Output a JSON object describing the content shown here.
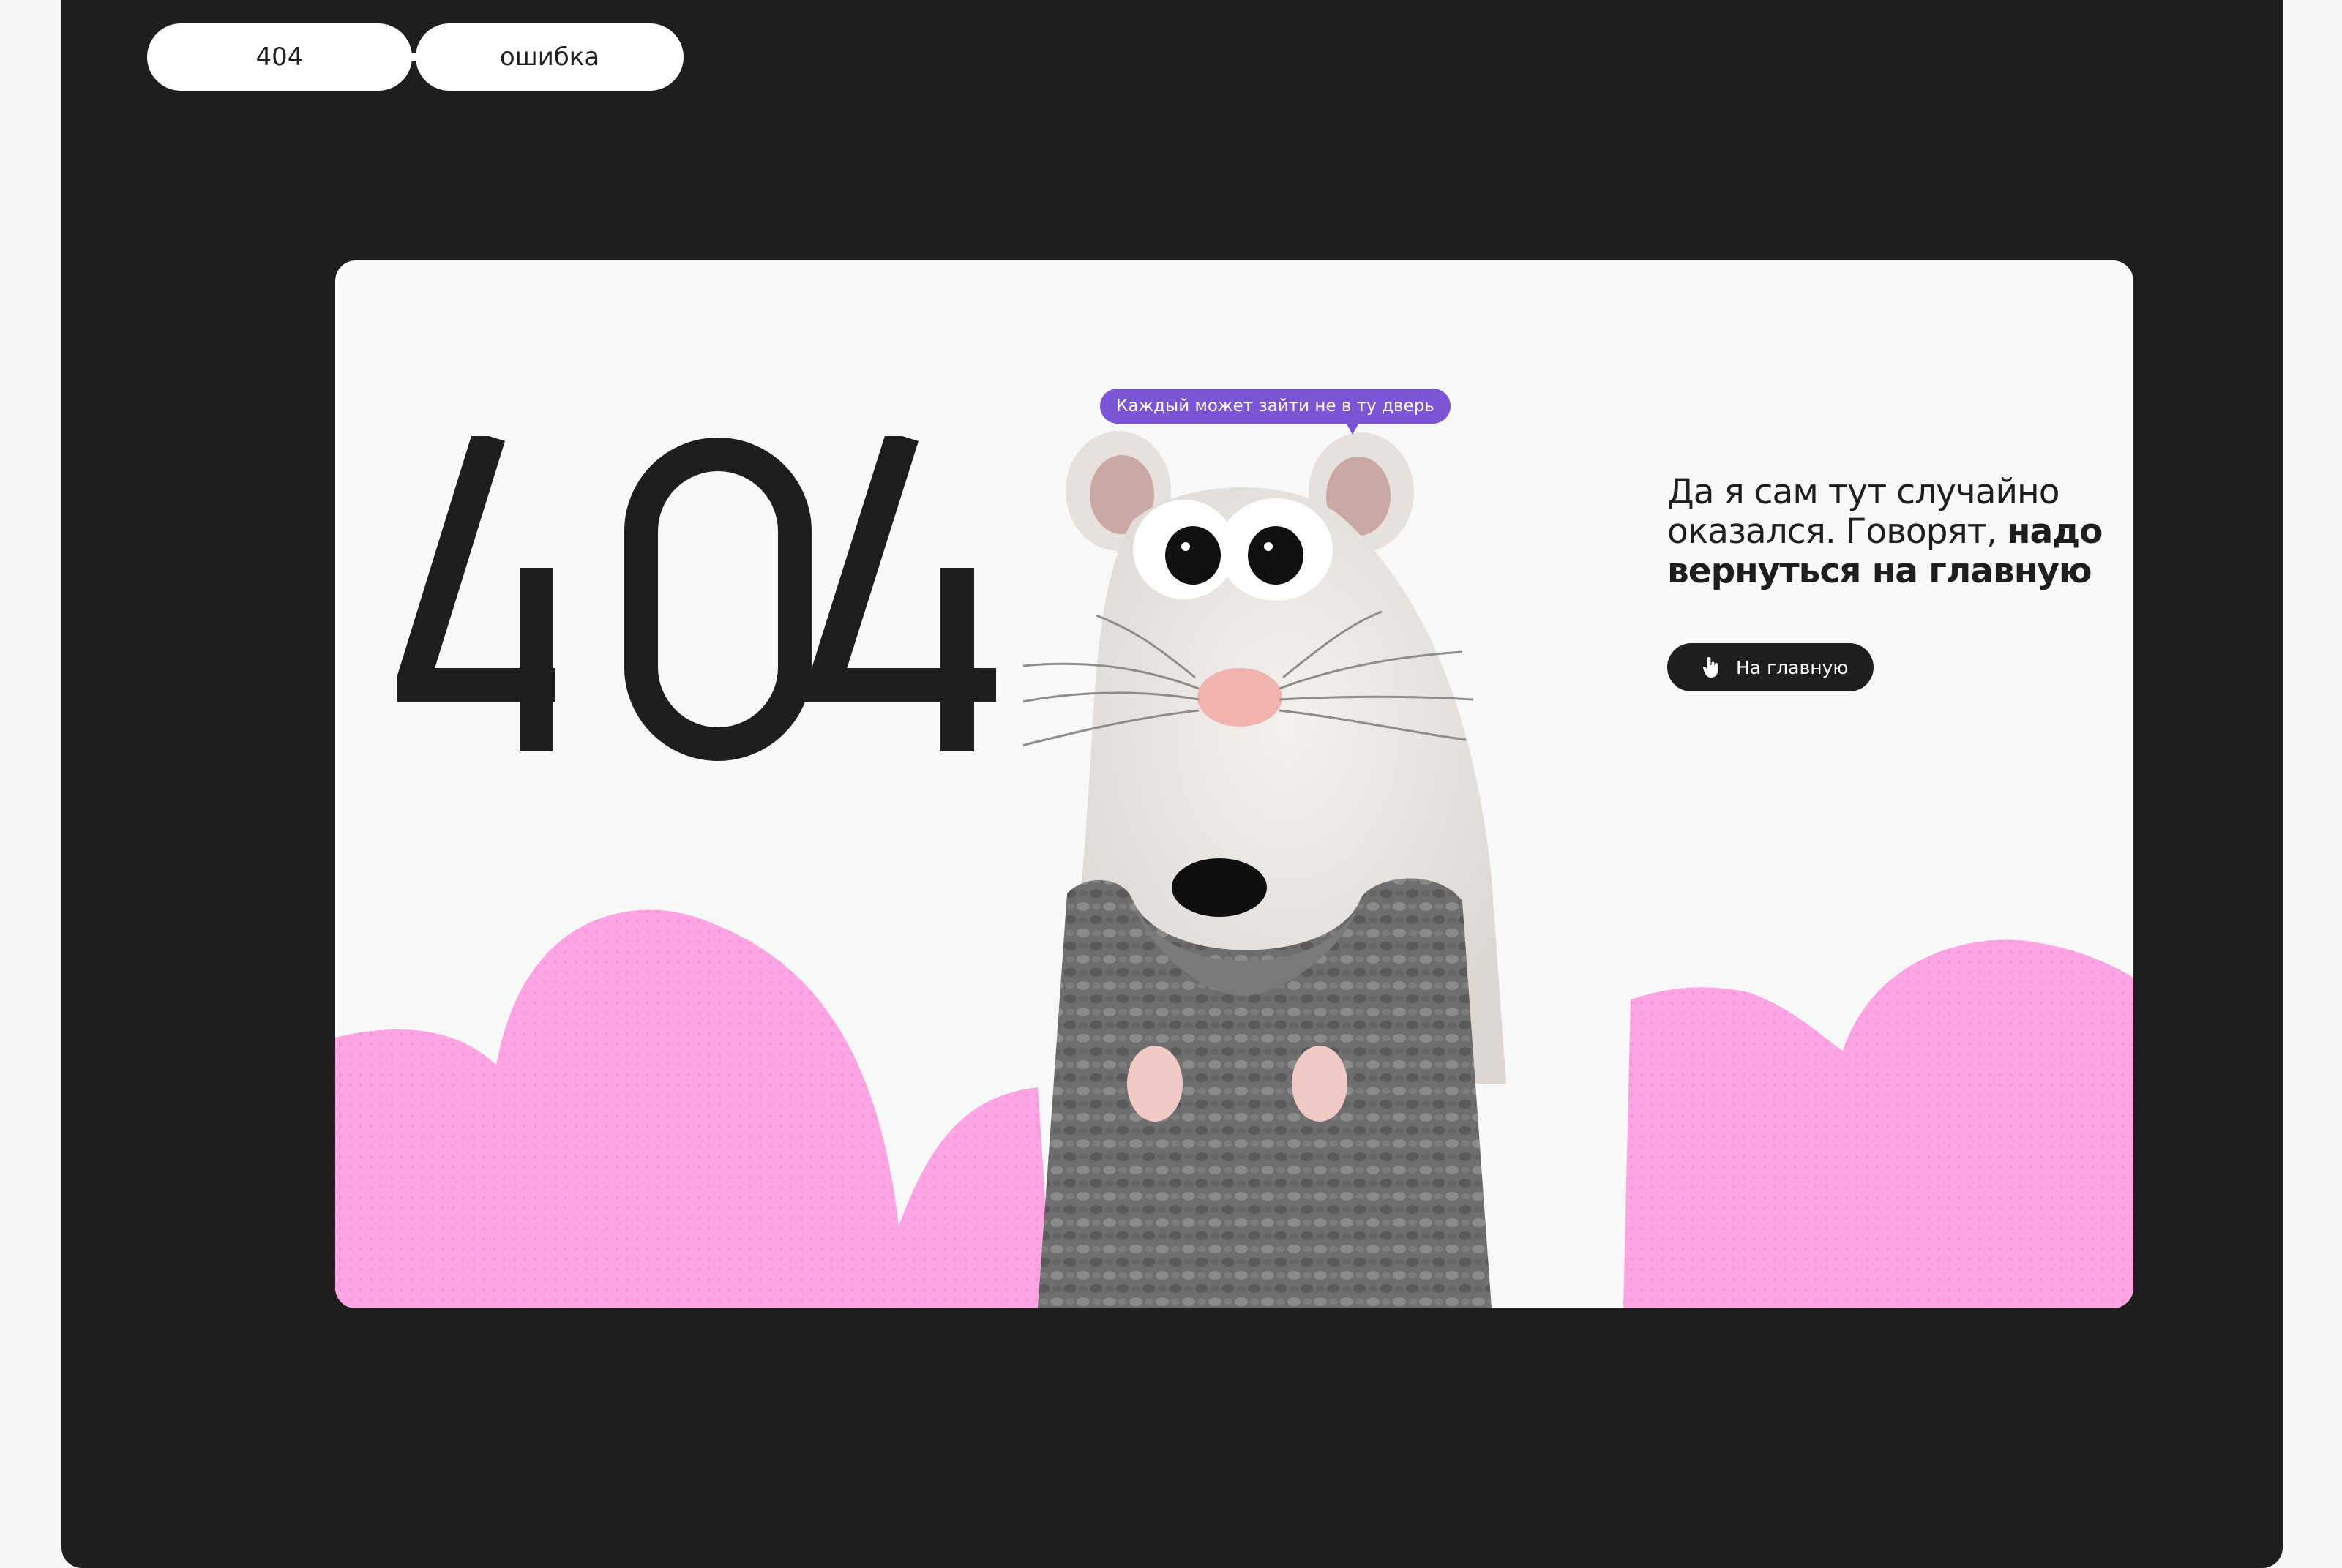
{
  "header": {
    "pill_code": "404",
    "pill_word": "ошибка"
  },
  "hero": {
    "code": "404",
    "speech_bubble": "Каждый может зайти не в ту дверь",
    "message_light": "Да я сам тут случайно оказался. Говорят, ",
    "message_bold": "надо вернуться на главную",
    "button_label": "На главную",
    "button_icon": "pointing-hand-icon",
    "character_icon": "mouse-in-sweater-illustration"
  },
  "colors": {
    "frame": "#1e1e1e",
    "card": "#f8f8f8",
    "cloud": "#fca4e4",
    "bubble": "#7b55d6",
    "button": "#1e1e1e",
    "sweater": "#6e6e6e"
  }
}
